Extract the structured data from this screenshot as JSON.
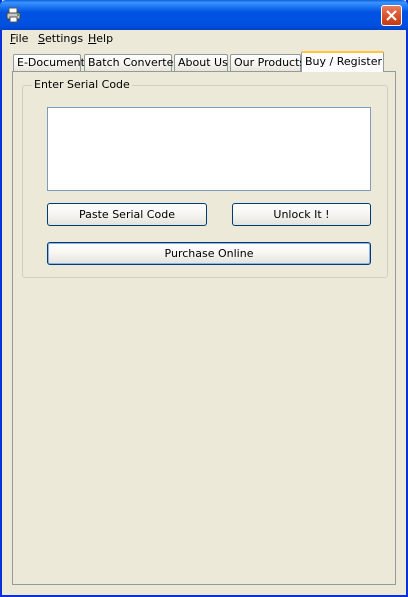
{
  "window": {
    "title": ""
  },
  "menu": [
    {
      "mnemonic": "F",
      "rest": "ile"
    },
    {
      "mnemonic": "S",
      "rest": "ettings"
    },
    {
      "mnemonic": "H",
      "rest": "elp"
    }
  ],
  "tabs": [
    {
      "label": "E-Document"
    },
    {
      "label": "Batch Converter"
    },
    {
      "label": "About Us"
    },
    {
      "label": "Our Products"
    },
    {
      "label": "Buy / Register",
      "active": true
    }
  ],
  "register": {
    "group_label": "Enter Serial Code",
    "serial_value": "",
    "paste_label": "Paste Serial Code",
    "unlock_label": "Unlock It !",
    "purchase_label": "Purchase Online"
  },
  "icons": {
    "app": "printer-icon",
    "close": "close-icon"
  },
  "colors": {
    "titlebar": "#0054E3",
    "close": "#D9542C",
    "active_tab_accent": "#FFC83C",
    "face": "#ECE9D8"
  }
}
